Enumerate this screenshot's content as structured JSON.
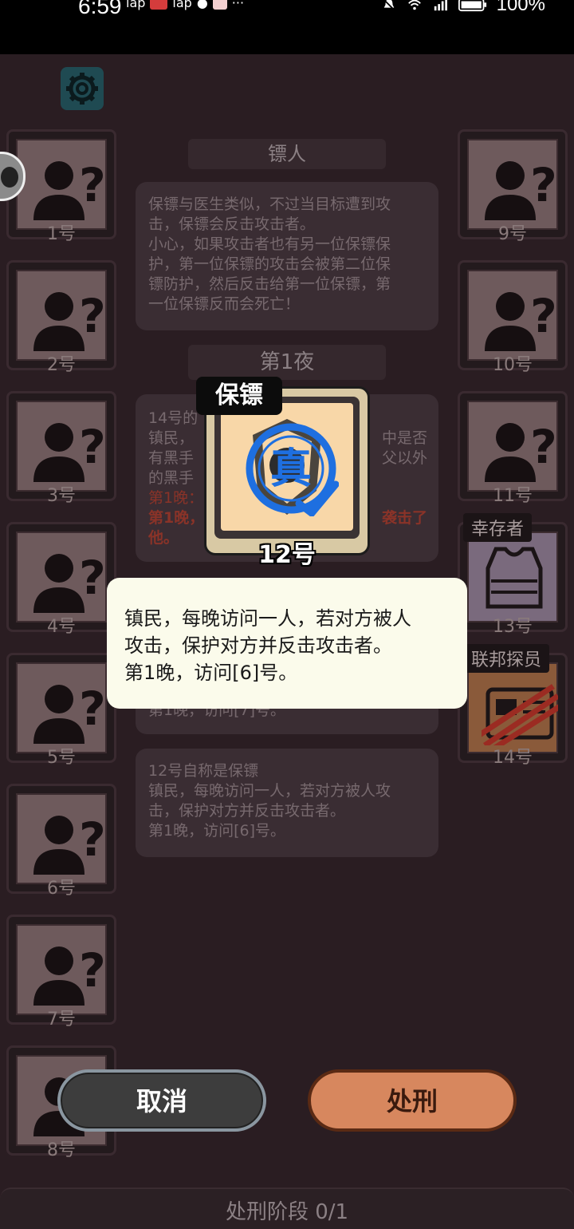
{
  "status_bar": {
    "time": "6:59",
    "app1": "lap",
    "app2": "lap",
    "more": "···",
    "battery": "100%"
  },
  "side_slots_left": [
    {
      "num": "1号"
    },
    {
      "num": "2号"
    },
    {
      "num": "3号"
    },
    {
      "num": "4号"
    },
    {
      "num": "5号"
    },
    {
      "num": "6号"
    },
    {
      "num": "7号"
    },
    {
      "num": "8号"
    }
  ],
  "side_slots_right": [
    {
      "num": "9号"
    },
    {
      "num": "10号"
    },
    {
      "num": "11号"
    },
    {
      "num": "13号",
      "role": "幸存者"
    },
    {
      "num": "14号",
      "role": "联邦探员"
    }
  ],
  "role_info": {
    "title": "镖人",
    "description_lines": [
      "保镖与医生类似，不过当目标遭到攻",
      "击，保镖会反击攻击者。",
      "小心，如果攻击者也有另一位保镖保",
      "护，第一位保镖的攻击会被第二位保",
      "镖防护，然后反击给第一位保镖，第",
      "一位保镖反而会死亡！"
    ]
  },
  "night": {
    "label": "第1夜",
    "card1_lines": [
      "14号的",
      "镇民，",
      "中是否",
      "有黑手",
      "父以外",
      "的黑手"
    ],
    "card1_line_visit": "第1晚：",
    "card1_red1": "第1晚，",
    "card1_red2": "袭击了",
    "card1_red3": "他。",
    "card2_line": "第1晚，访问[7]号。",
    "card3_lines": [
      "12号自称是保镖",
      "镇民，每晚访问一人，若对方被人攻",
      "击，保护对方并反击攻击者。",
      "第1晚，访问[6]号。"
    ]
  },
  "popup": {
    "role_name": "保镖",
    "stamp": "真",
    "player_num": "12号"
  },
  "tooltip": {
    "lines": [
      "镇民，每晚访问一人，若对方被人",
      "攻击，保护对方并反击攻击者。",
      "第1晚，访问[6]号。"
    ]
  },
  "buttons": {
    "cancel": "取消",
    "execute": "处刑"
  },
  "phase": {
    "label": "处刑阶段 0/1"
  },
  "colors": {
    "background": "#2a1d22",
    "tooltip_bg": "#fbfbeb",
    "stamp_blue": "#1e6fe0",
    "execute_button": "#d7875e"
  }
}
